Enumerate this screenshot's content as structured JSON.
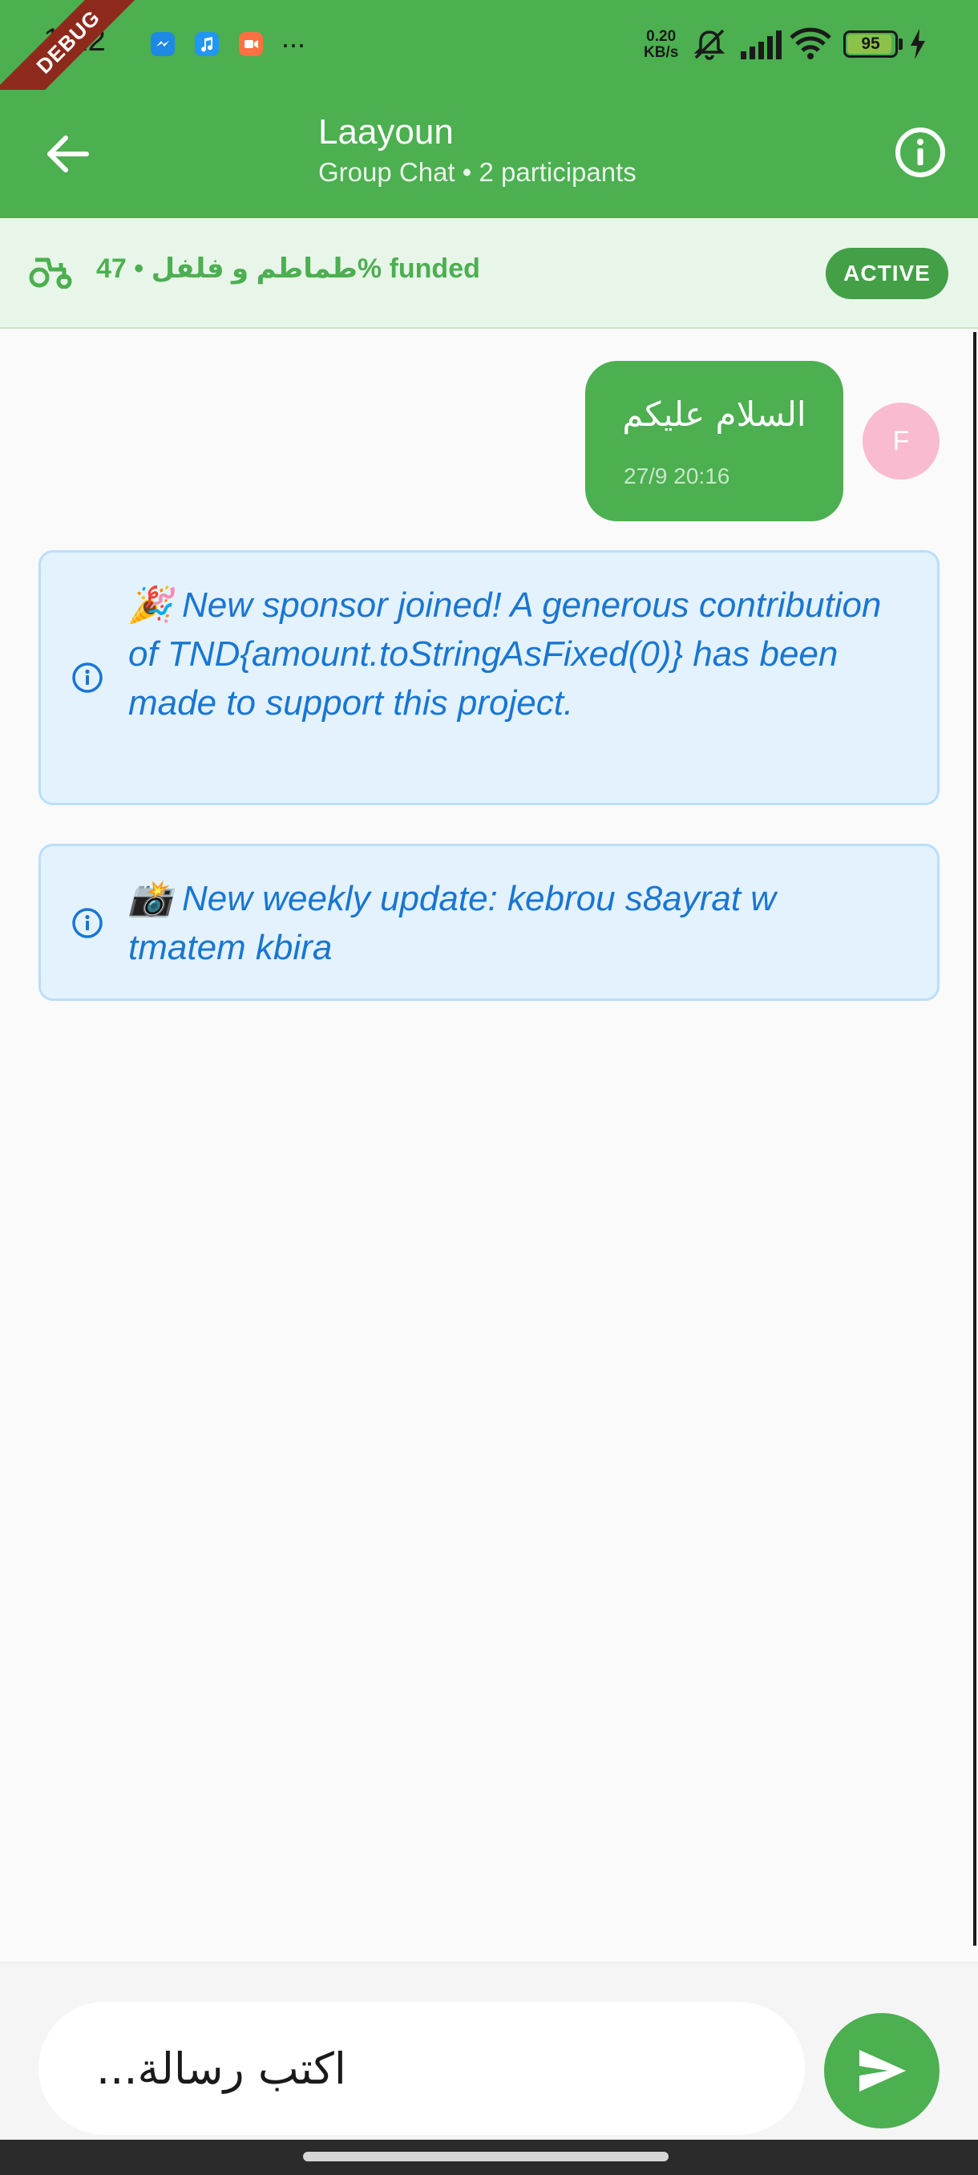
{
  "status_bar": {
    "time": "1:22",
    "net_speed_value": "0.20",
    "net_speed_unit": "KB/s",
    "battery_level": 95,
    "battery_text": "95",
    "overflow": "···"
  },
  "debug_banner": "DEBUG",
  "app_bar": {
    "title": "Laayoun",
    "subtitle": "Group Chat • 2 participants"
  },
  "project_banner": {
    "text": "47 • طماطم و فلفل% funded",
    "status": "ACTIVE"
  },
  "messages": [
    {
      "type": "user",
      "text": "السلام عليكم",
      "time": "27/9 20:16",
      "avatar_initial": "F"
    },
    {
      "type": "system",
      "text": "🎉 New sponsor joined! A generous contribution of TND{amount.toStringAsFixed(0)} has been made to support this project."
    },
    {
      "type": "system",
      "text": "📸 New weekly update: kebrou s8ayrat w tmatem kbira"
    }
  ],
  "composer": {
    "placeholder": "اكتب رسالة..."
  },
  "colors": {
    "primary": "#4caf50",
    "system_bg": "#e3f2fd",
    "system_text": "#1976d2",
    "avatar_bg": "#f8bbd0"
  },
  "icons": [
    "back-arrow-icon",
    "info-icon",
    "tractor-icon",
    "send-icon",
    "messenger-icon",
    "music-icon",
    "video-icon",
    "mute-icon",
    "signal-icon",
    "wifi-icon",
    "charging-icon"
  ]
}
